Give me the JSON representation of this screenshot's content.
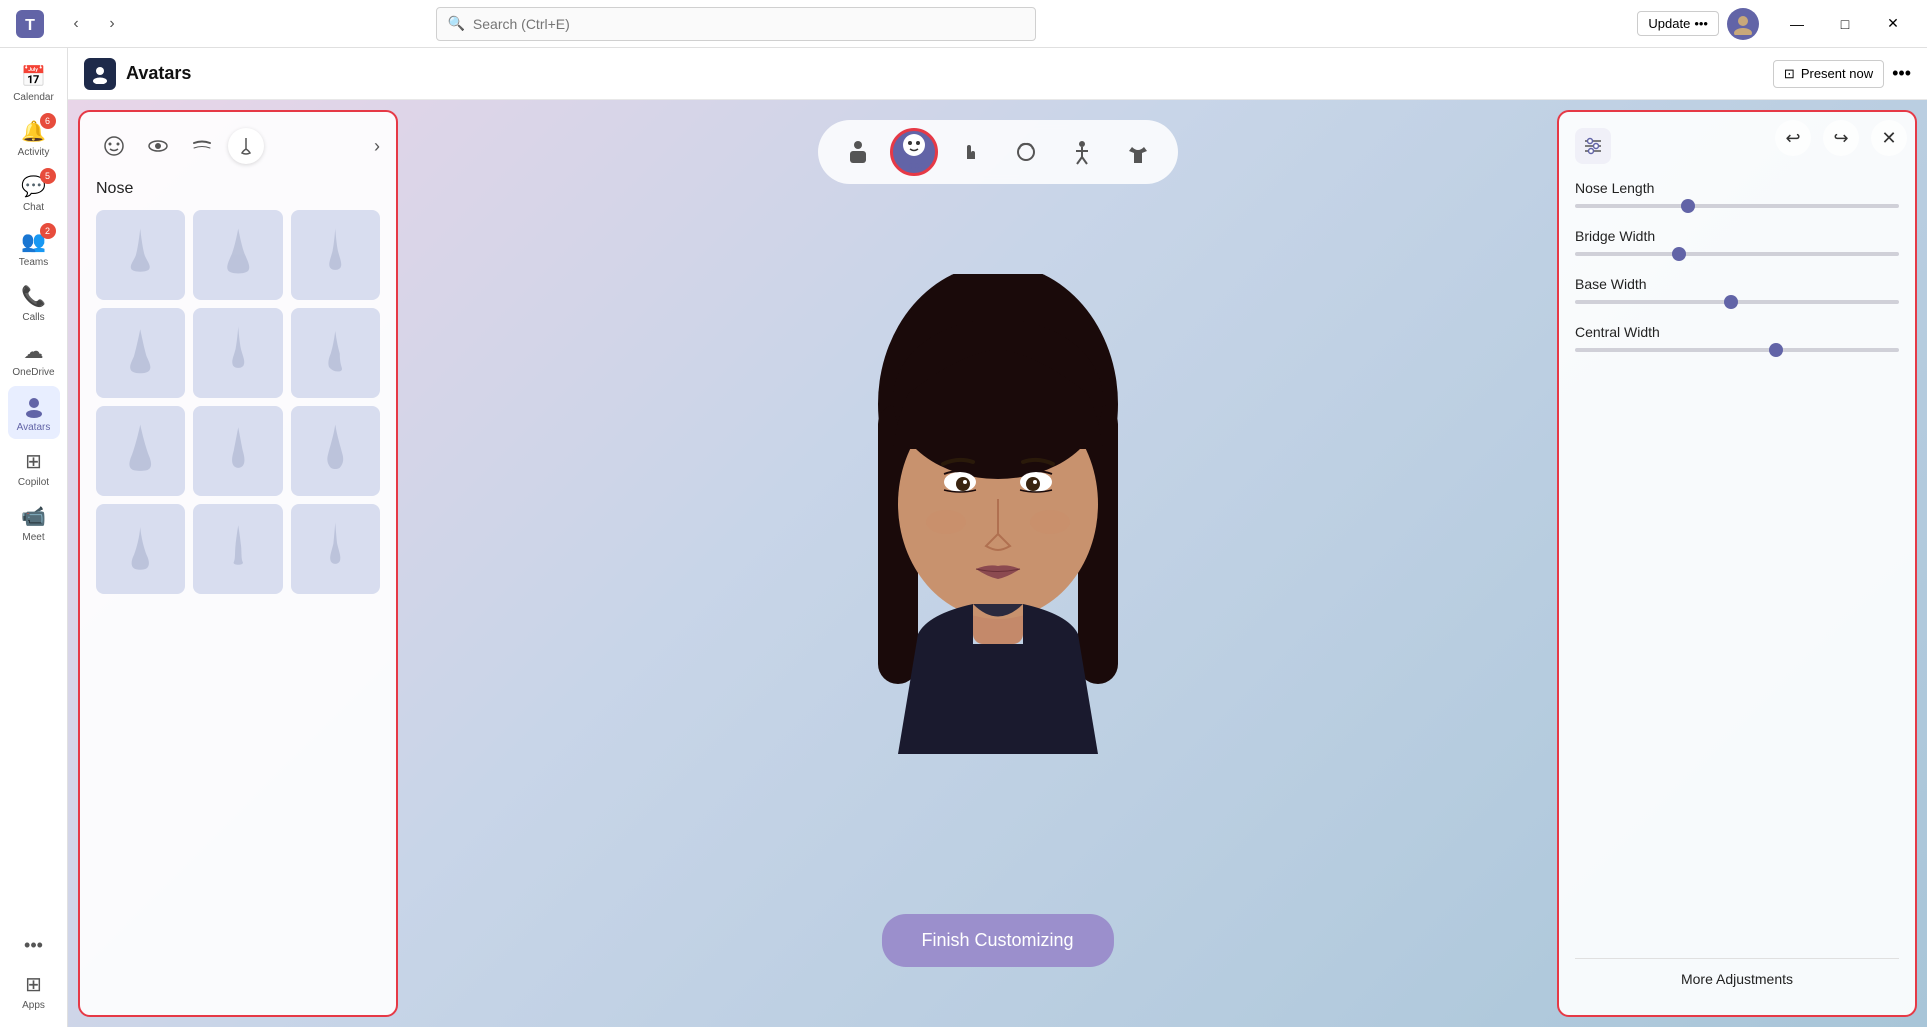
{
  "titlebar": {
    "search_placeholder": "Search (Ctrl+E)",
    "update_label": "Update",
    "update_dots": "•••",
    "minimize": "—",
    "maximize": "□",
    "close": "✕"
  },
  "sidebar": {
    "items": [
      {
        "id": "calendar",
        "label": "Calendar",
        "icon": "📅",
        "badge": null
      },
      {
        "id": "activity",
        "label": "Activity",
        "icon": "🔔",
        "badge": "6"
      },
      {
        "id": "chat",
        "label": "Chat",
        "icon": "💬",
        "badge": "5"
      },
      {
        "id": "teams",
        "label": "Teams",
        "icon": "👥",
        "badge": "2"
      },
      {
        "id": "calls",
        "label": "Calls",
        "icon": "📞",
        "badge": null
      },
      {
        "id": "onedrive",
        "label": "OneDrive",
        "icon": "☁",
        "badge": null
      },
      {
        "id": "avatars",
        "label": "Avatars",
        "icon": "👤",
        "badge": null,
        "active": true
      },
      {
        "id": "copilot",
        "label": "Copilot",
        "icon": "⊞",
        "badge": null
      },
      {
        "id": "meet",
        "label": "Meet",
        "icon": "📹",
        "badge": null
      }
    ],
    "more_label": "•••",
    "apps_label": "Apps",
    "apps_icon": "⊞"
  },
  "app_header": {
    "icon": "👤",
    "title": "Avatars",
    "present_now": "Present now",
    "more_dots": "•••"
  },
  "category_tabs": [
    {
      "id": "body",
      "icon": "🧍",
      "label": ""
    },
    {
      "id": "face",
      "icon": "😊",
      "label": "Face",
      "selected": true
    },
    {
      "id": "gesture",
      "icon": "✋",
      "label": ""
    },
    {
      "id": "hair",
      "icon": "💇",
      "label": ""
    },
    {
      "id": "pose",
      "icon": "🤸",
      "label": ""
    },
    {
      "id": "outfit",
      "icon": "👕",
      "label": ""
    }
  ],
  "editor_controls": {
    "undo": "↩",
    "redo": "↪",
    "close": "✕"
  },
  "left_panel": {
    "feature_tabs": [
      {
        "id": "face-shape",
        "icon": "😊"
      },
      {
        "id": "eyes",
        "icon": "👁"
      },
      {
        "id": "eyebrows",
        "icon": "〰"
      },
      {
        "id": "nose",
        "icon": "👃",
        "active": true
      },
      {
        "id": "next",
        "icon": "›"
      }
    ],
    "section_label": "Nose",
    "nose_options": [
      1,
      2,
      3,
      4,
      5,
      6,
      7,
      8,
      9,
      10,
      11,
      12
    ]
  },
  "right_panel": {
    "sliders": [
      {
        "label": "Nose Length",
        "value": 35
      },
      {
        "label": "Bridge Width",
        "value": 32
      },
      {
        "label": "Base Width",
        "value": 48
      },
      {
        "label": "Central Width",
        "value": 62
      }
    ],
    "more_label": "More Adjustments"
  },
  "finish_btn": {
    "label": "Finish Customizing"
  }
}
